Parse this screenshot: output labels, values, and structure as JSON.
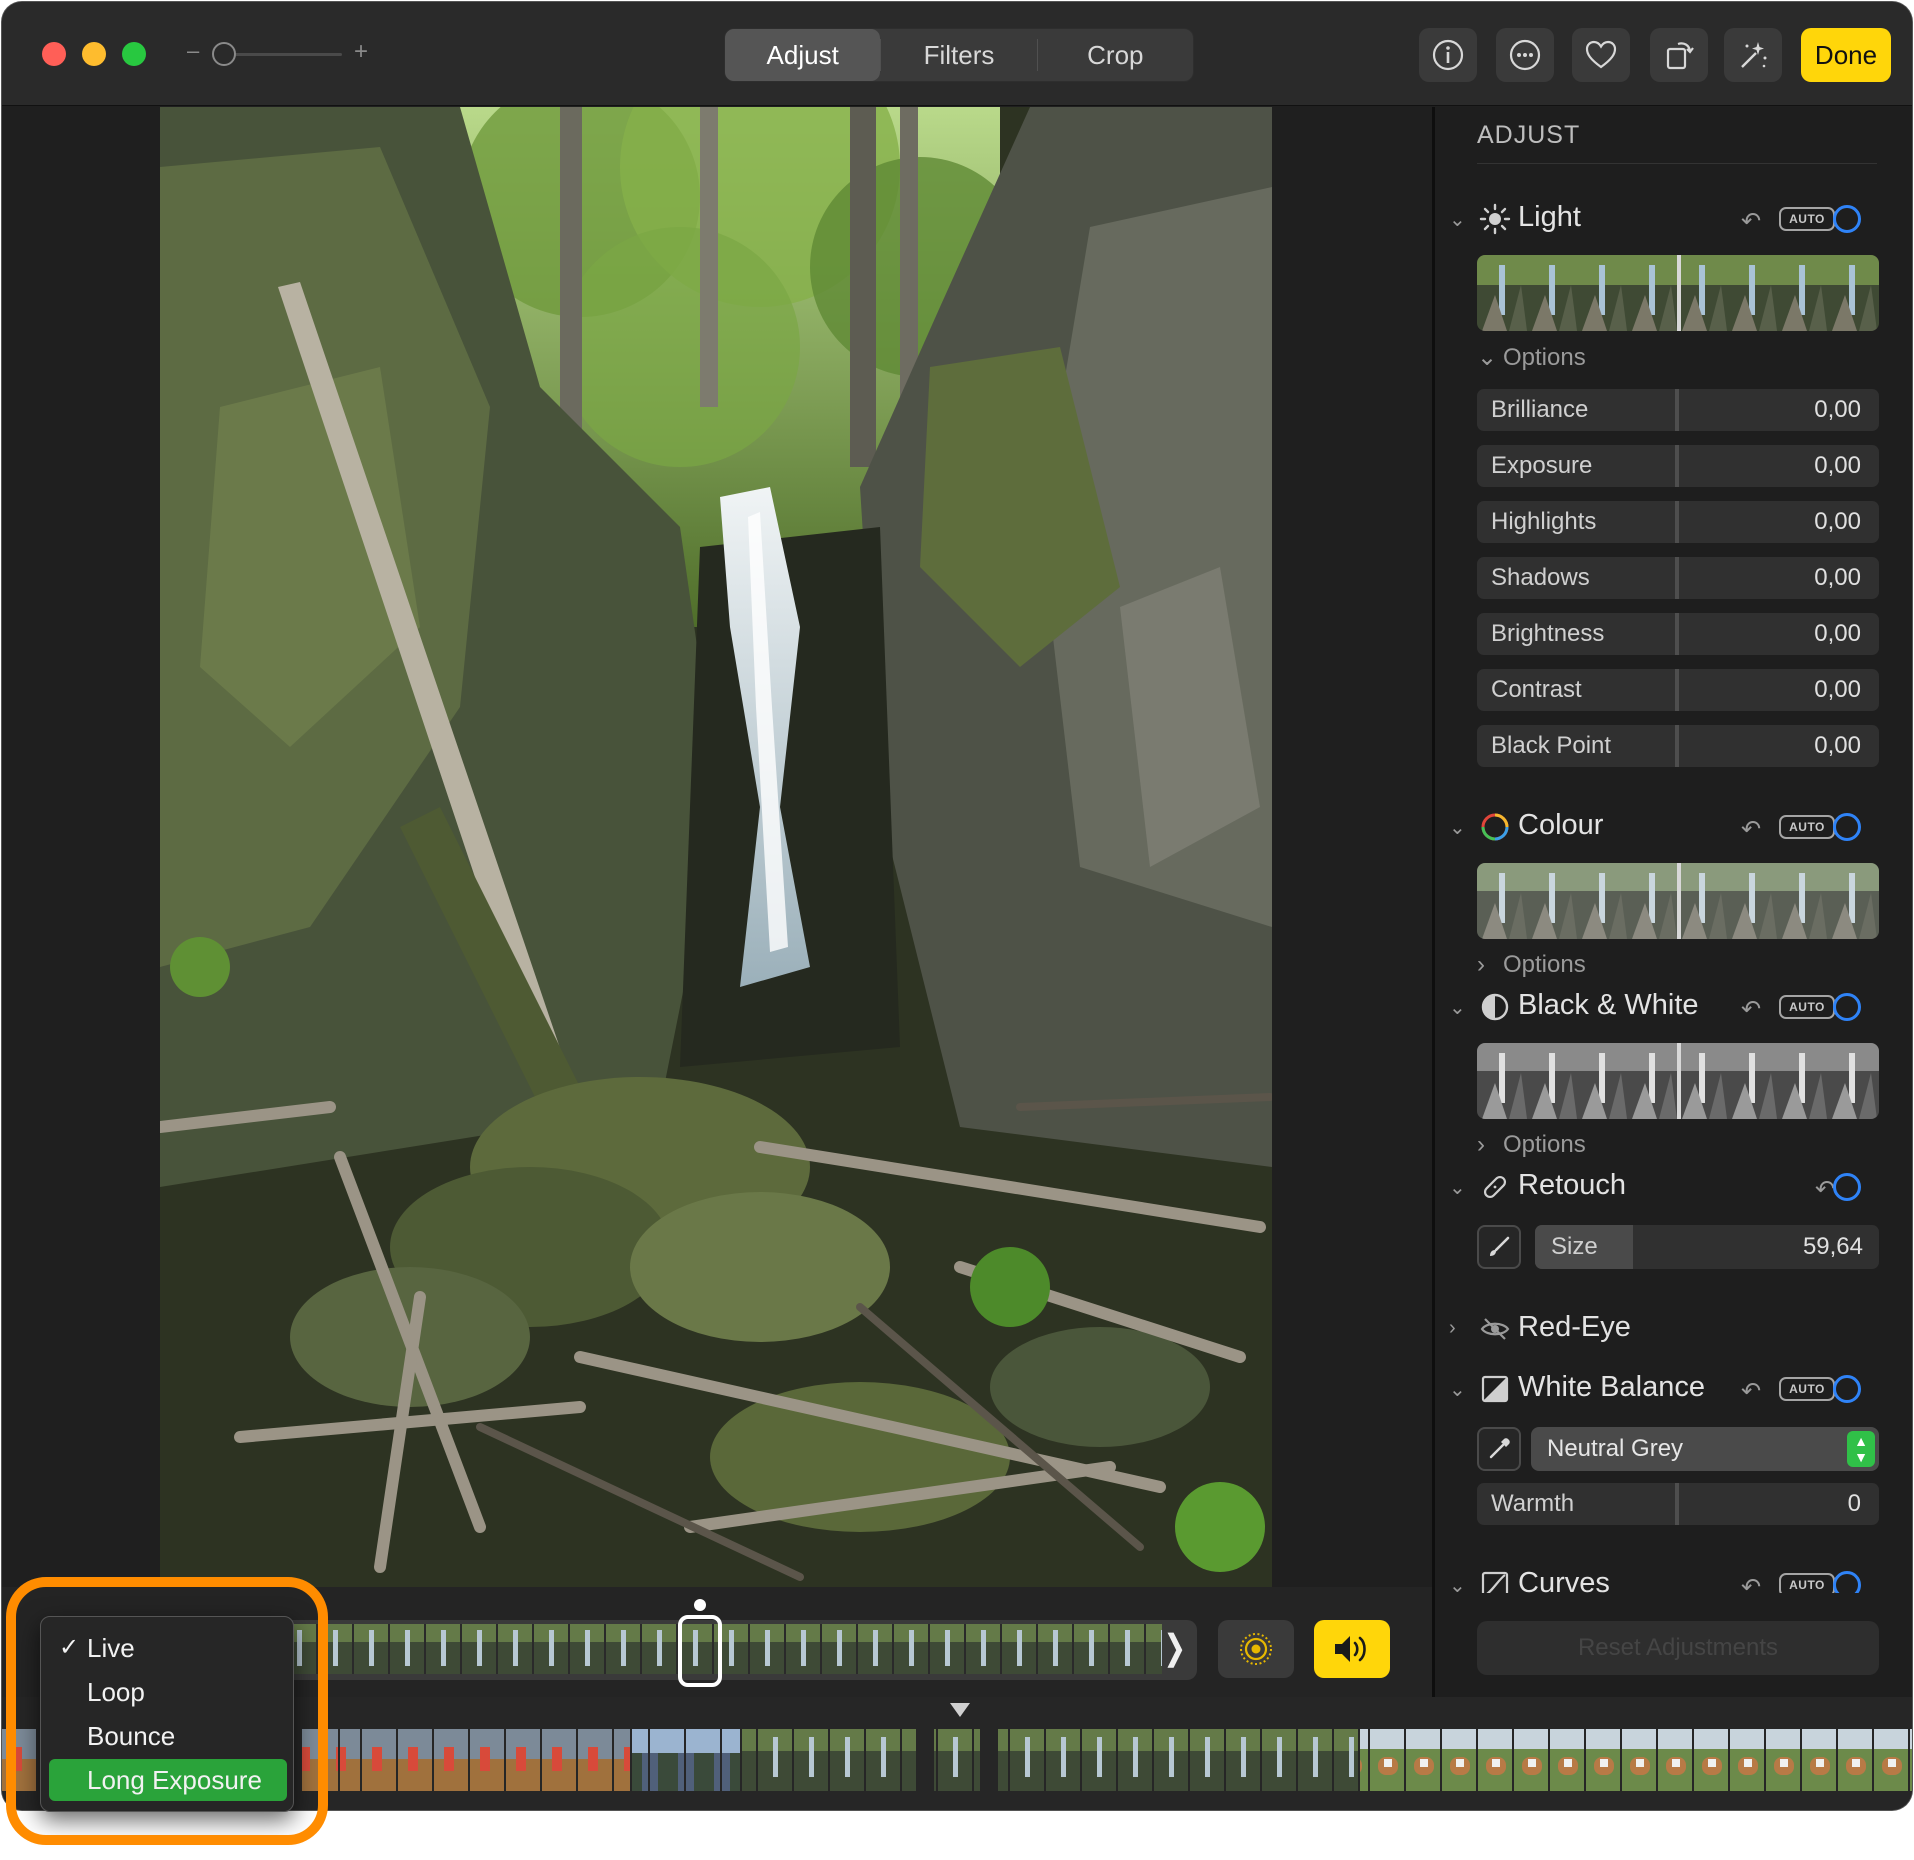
{
  "toolbar": {
    "zoom_minus": "–",
    "zoom_plus": "+",
    "tabs": [
      {
        "label": "Adjust",
        "active": true
      },
      {
        "label": "Filters",
        "active": false
      },
      {
        "label": "Crop",
        "active": false
      }
    ],
    "icons": [
      "info-icon",
      "more-icon",
      "heart-icon",
      "rotate-icon",
      "auto-enhance-icon"
    ],
    "done_label": "Done",
    "accent_color": "#ffd60a"
  },
  "sidebar": {
    "title": "ADJUST",
    "light": {
      "label": "Light",
      "auto": "AUTO",
      "options_label": "Options",
      "sliders": [
        {
          "label": "Brilliance",
          "value": "0,00"
        },
        {
          "label": "Exposure",
          "value": "0,00"
        },
        {
          "label": "Highlights",
          "value": "0,00"
        },
        {
          "label": "Shadows",
          "value": "0,00"
        },
        {
          "label": "Brightness",
          "value": "0,00"
        },
        {
          "label": "Contrast",
          "value": "0,00"
        },
        {
          "label": "Black Point",
          "value": "0,00"
        }
      ]
    },
    "colour": {
      "label": "Colour",
      "auto": "AUTO",
      "options_label": "Options"
    },
    "bw": {
      "label": "Black & White",
      "auto": "AUTO",
      "options_label": "Options"
    },
    "retouch": {
      "label": "Retouch",
      "size_label": "Size",
      "size_value": "59,64"
    },
    "redeye": {
      "label": "Red-Eye"
    },
    "white_balance": {
      "label": "White Balance",
      "auto": "AUTO",
      "mode": "Neutral Grey",
      "warmth_label": "Warmth",
      "warmth_value": "0"
    },
    "curves": {
      "label": "Curves",
      "auto": "AUTO"
    },
    "reset_label": "Reset Adjustments"
  },
  "live_menu": {
    "items": [
      {
        "label": "Live",
        "checked": true,
        "selected": false
      },
      {
        "label": "Loop",
        "checked": false,
        "selected": false
      },
      {
        "label": "Bounce",
        "checked": false,
        "selected": false
      },
      {
        "label": "Long Exposure",
        "checked": false,
        "selected": true
      }
    ],
    "check_glyph": "✓",
    "highlight_color": "#2aa33a",
    "callout_color": "#ff8c00"
  }
}
